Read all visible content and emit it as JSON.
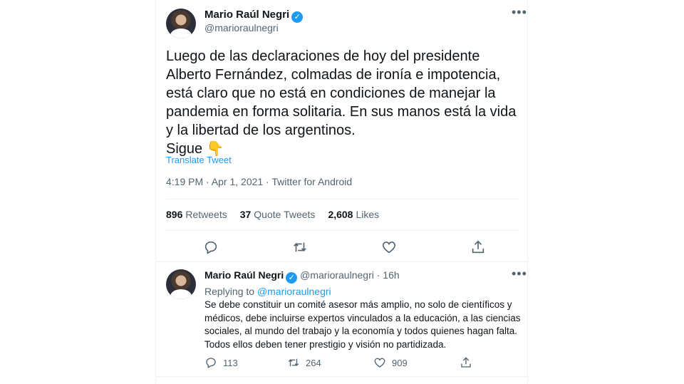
{
  "main": {
    "author_name": "Mario Raúl Negri",
    "author_handle": "@marioraulnegri",
    "more_glyph": "•••",
    "text": "Luego de las declaraciones de hoy del presidente Alberto Fernández, colmadas de ironía e impotencia, está claro que no está en condiciones de manejar la pandemia en forma solitaria. En sus manos está la vida y la libertad de los argentinos.",
    "text_last": "Sigue",
    "emoji": "👇",
    "translate_label": "Translate Tweet",
    "meta": "4:19 PM · Apr 1, 2021 · Twitter for Android",
    "stats": {
      "retweets_count": "896",
      "retweets_label": "Retweets",
      "quotes_count": "37",
      "quotes_label": "Quote Tweets",
      "likes_count": "2,608",
      "likes_label": "Likes"
    }
  },
  "reply": {
    "author_name": "Mario Raúl Negri",
    "author_handle": "@marioraulnegri",
    "time": "· 16h",
    "replying_prefix": "Replying to",
    "replying_to": "@marioraulnegri",
    "text": "Se debe constituir un comité asesor más amplio, no solo de científicos y médicos, debe incluirse expertos vinculados a la educación, a las ciencias sociales, al mundo del trabajo y la economía y todos quienes hagan falta. Todos ellos deben tener prestigio y visión no partidizada.",
    "replies": "113",
    "retweets": "264",
    "likes": "909"
  },
  "colors": {
    "accent": "#1d9bf0",
    "muted": "#536471",
    "text": "#0f1419",
    "divider": "#eff3f4"
  },
  "icons": [
    "verified-badge-icon",
    "more-icon",
    "reply-icon",
    "retweet-icon",
    "like-icon",
    "share-icon"
  ]
}
